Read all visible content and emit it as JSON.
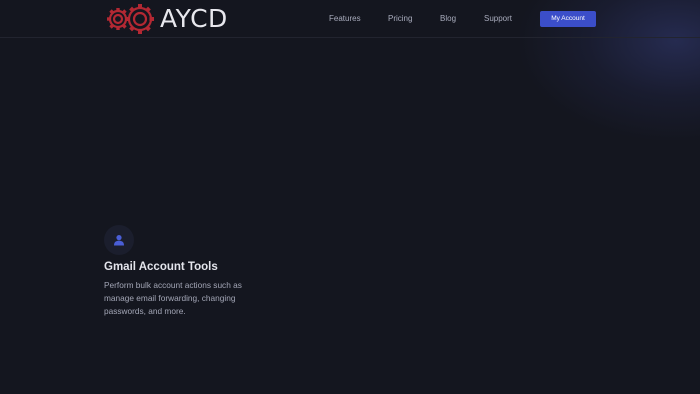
{
  "header": {
    "logo_text": "AYCD",
    "nav": [
      {
        "label": "Features"
      },
      {
        "label": "Pricing"
      },
      {
        "label": "Blog"
      },
      {
        "label": "Support"
      }
    ],
    "account_button": "My Account"
  },
  "feature": {
    "icon": "user-icon",
    "title": "Gmail Account Tools",
    "description": "Perform bulk account actions such as manage email forwarding, changing passwords, and more."
  },
  "colors": {
    "background": "#14161f",
    "accent": "#3b4ec9",
    "logo_gear": "#b32833",
    "icon": "#4a5ed6"
  }
}
